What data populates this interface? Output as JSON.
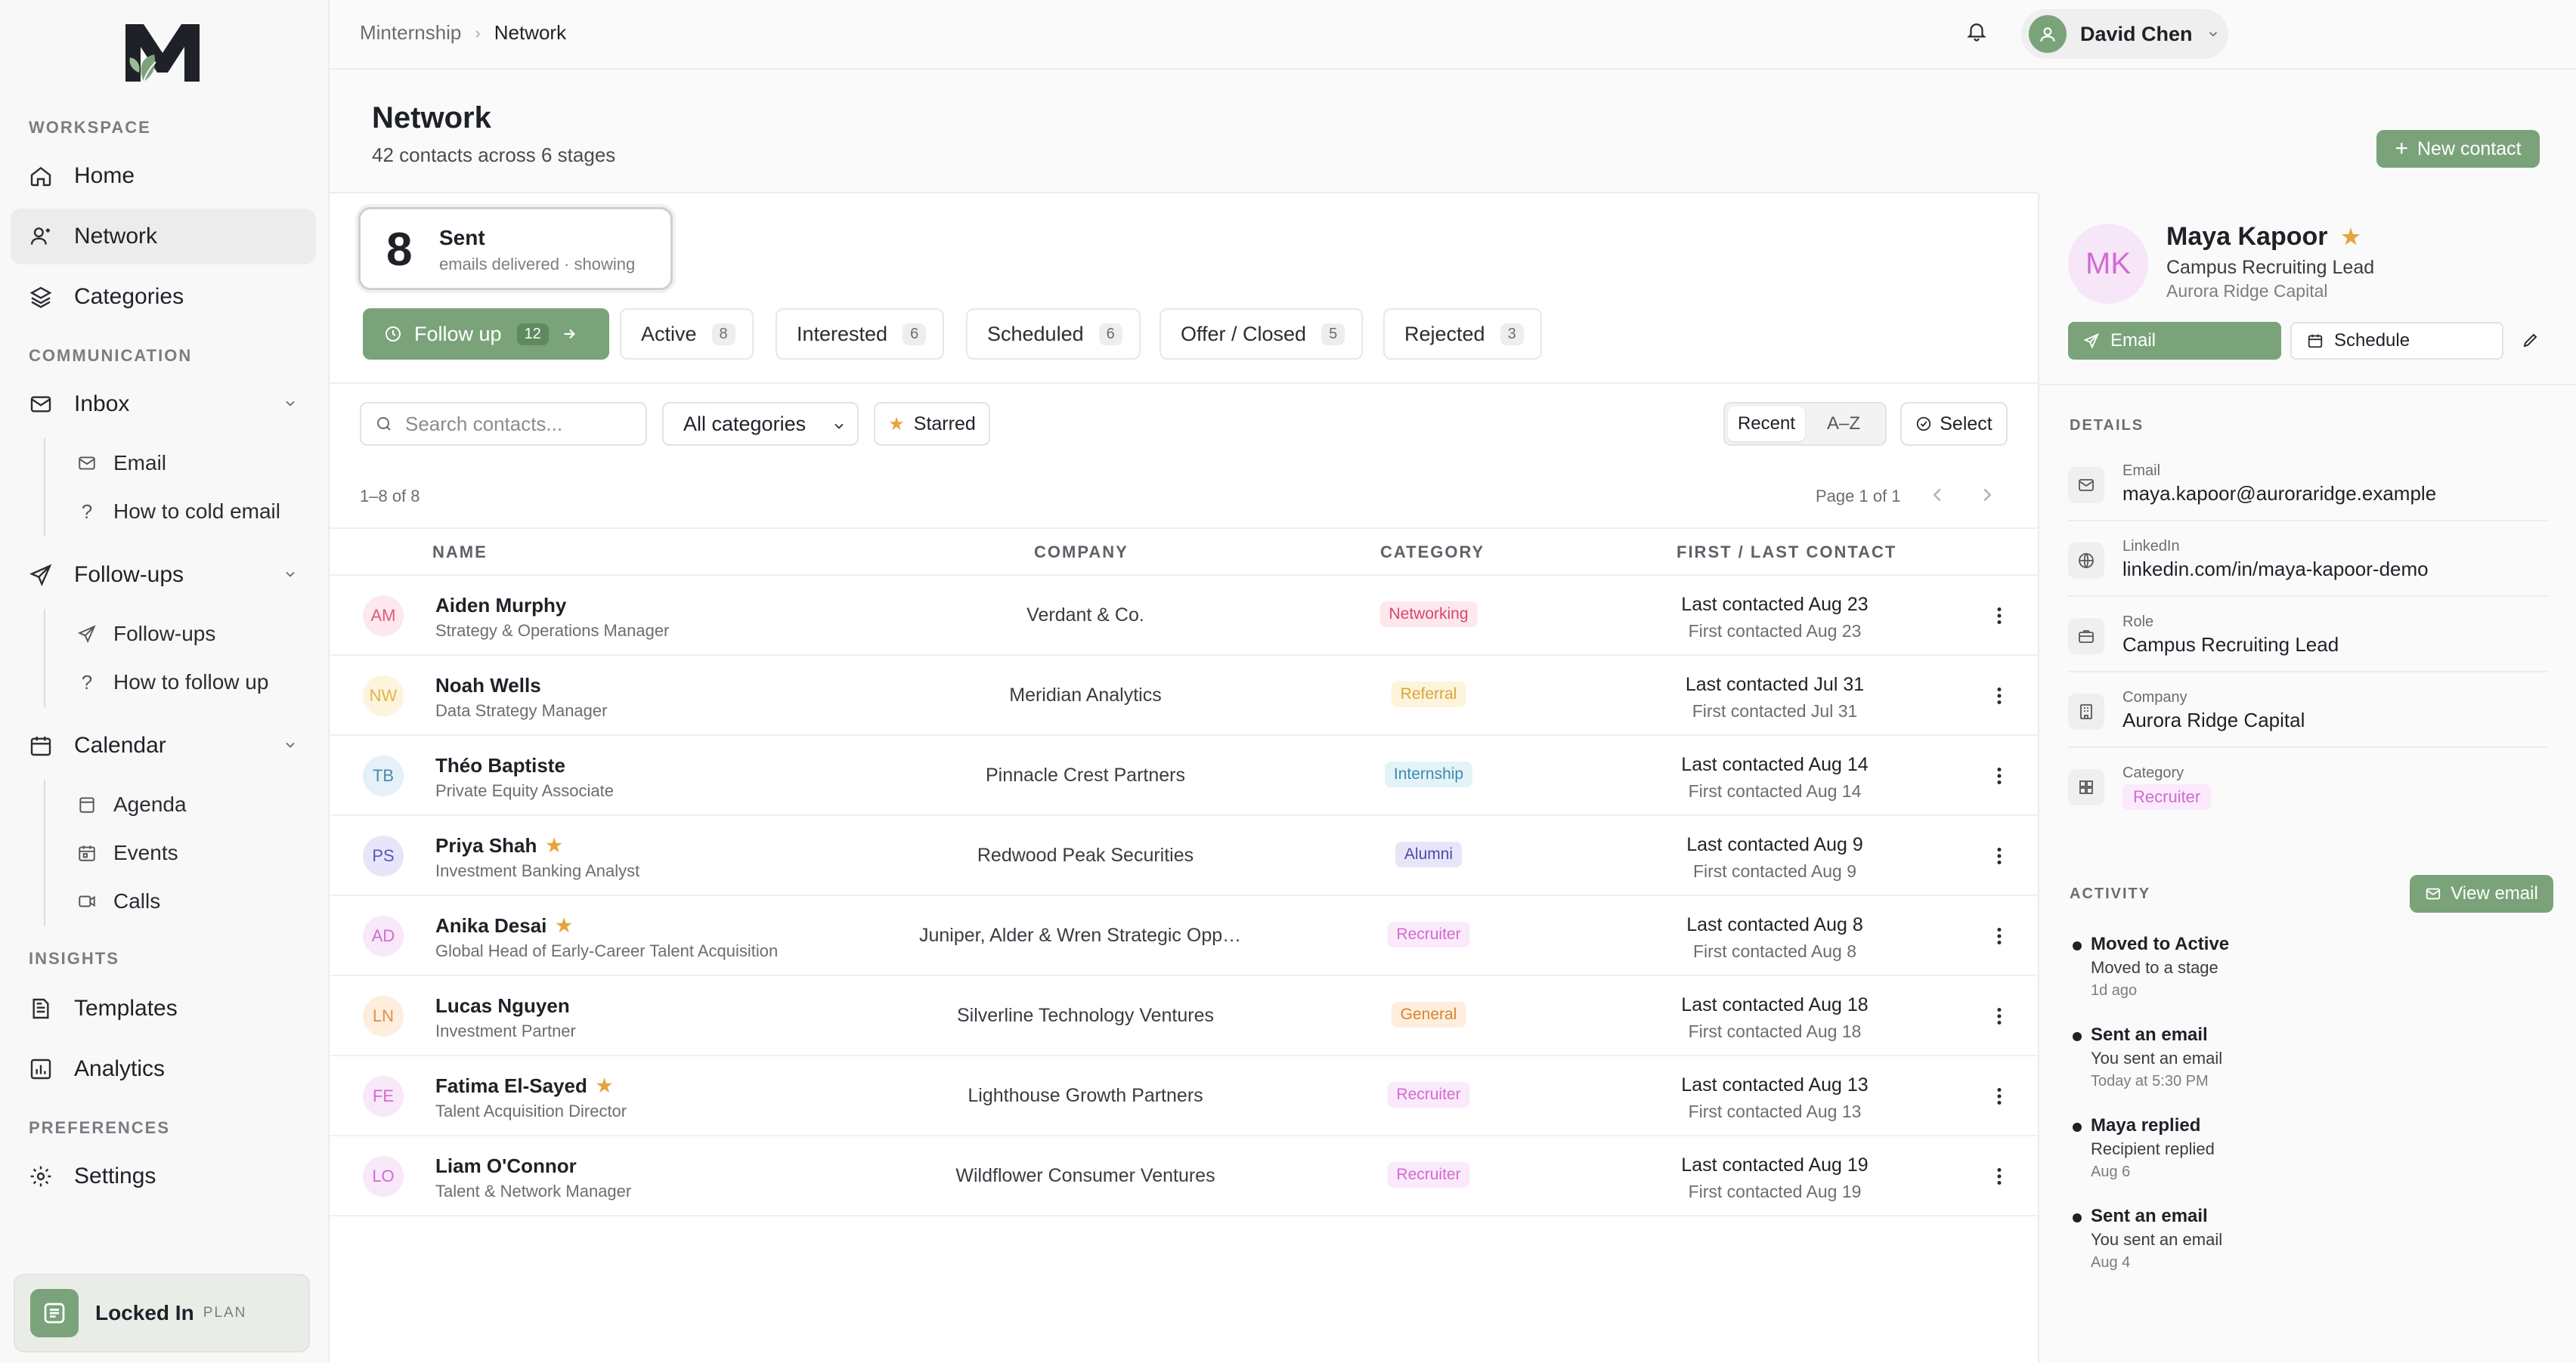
{
  "brand": {
    "accent": "#7aa37a"
  },
  "breadcrumb": {
    "root": "Minternship",
    "current": "Network"
  },
  "user": {
    "name": "David Chen"
  },
  "sidebar": {
    "sections": {
      "workspace": "WORKSPACE",
      "communication": "COMMUNICATION",
      "insights": "INSIGHTS",
      "preferences": "PREFERENCES"
    },
    "home": "Home",
    "network": "Network",
    "categories": "Categories",
    "inbox": "Inbox",
    "inbox_email": "Email",
    "inbox_cold": "How to cold email",
    "followups": "Follow-ups",
    "followups_sub": "Follow-ups",
    "followups_how": "How to follow up",
    "calendar": "Calendar",
    "agenda": "Agenda",
    "events": "Events",
    "calls": "Calls",
    "templates": "Templates",
    "analytics": "Analytics",
    "settings": "Settings",
    "plan_name": "Locked In",
    "plan_label": "PLAN"
  },
  "page": {
    "title": "Network",
    "subtitle": "42 contacts across 6 stages",
    "new_contact": "New contact"
  },
  "sent_card": {
    "count": "8",
    "label": "Sent",
    "sub": "emails delivered · showing"
  },
  "stages": [
    {
      "label": "Follow up",
      "count": "12"
    },
    {
      "label": "Active",
      "count": "8"
    },
    {
      "label": "Interested",
      "count": "6"
    },
    {
      "label": "Scheduled",
      "count": "6"
    },
    {
      "label": "Offer / Closed",
      "count": "5"
    },
    {
      "label": "Rejected",
      "count": "3"
    }
  ],
  "filters": {
    "search_placeholder": "Search contacts...",
    "category": "All categories",
    "starred": "Starred",
    "sort_recent": "Recent",
    "sort_az": "A–Z",
    "select": "Select"
  },
  "table": {
    "range": "1–8 of 8",
    "page": "Page 1 of 1",
    "headers": {
      "name": "NAME",
      "company": "COMPANY",
      "category": "CATEGORY",
      "contact": "FIRST / LAST CONTACT"
    },
    "rows": [
      {
        "initials": "AM",
        "name": "Aiden Murphy",
        "role": "Strategy & Operations Manager",
        "company": "Verdant & Co.",
        "category": "Networking",
        "last": "Last contacted Aug 23",
        "first": "First contacted Aug 23",
        "starred": false,
        "avatar_bg": "#fde8ee",
        "avatar_fg": "#e05a7a",
        "cat_bg": "#fde8ee",
        "cat_fg": "#d9466a"
      },
      {
        "initials": "NW",
        "name": "Noah Wells",
        "role": "Data Strategy Manager",
        "company": "Meridian Analytics",
        "category": "Referral",
        "last": "Last contacted Jul 31",
        "first": "First contacted Jul 31",
        "starred": false,
        "avatar_bg": "#fdf4dc",
        "avatar_fg": "#e0b64a",
        "cat_bg": "#fdf4dc",
        "cat_fg": "#d8a63a"
      },
      {
        "initials": "TB",
        "name": "Théo Baptiste",
        "role": "Private Equity Associate",
        "company": "Pinnacle Crest Partners",
        "category": "Internship",
        "last": "Last contacted Aug 14",
        "first": "First contacted Aug 14",
        "starred": false,
        "avatar_bg": "#e4f1f7",
        "avatar_fg": "#4a8aa6",
        "cat_bg": "#e4f3f8",
        "cat_fg": "#3a8bb0"
      },
      {
        "initials": "PS",
        "name": "Priya Shah",
        "role": "Investment Banking Analyst",
        "company": "Redwood Peak Securities",
        "category": "Alumni",
        "last": "Last contacted Aug 9",
        "first": "First contacted Aug 9",
        "starred": true,
        "avatar_bg": "#e7e6f8",
        "avatar_fg": "#5a55b8",
        "cat_bg": "#e7e6f8",
        "cat_fg": "#4e48b0"
      },
      {
        "initials": "AD",
        "name": "Anika Desai",
        "role": "Global Head of Early-Career Talent Acquisition",
        "company": "Juniper, Alder & Wren Strategic Opport...",
        "category": "Recruiter",
        "last": "Last contacted Aug 8",
        "first": "First contacted Aug 8",
        "starred": true,
        "avatar_bg": "#f8e8f8",
        "avatar_fg": "#d06bd4",
        "cat_bg": "#fbeafb",
        "cat_fg": "#d06bd4"
      },
      {
        "initials": "LN",
        "name": "Lucas Nguyen",
        "role": "Investment Partner",
        "company": "Silverline Technology Ventures",
        "category": "General",
        "last": "Last contacted Aug 18",
        "first": "First contacted Aug 18",
        "starred": false,
        "avatar_bg": "#fdeede",
        "avatar_fg": "#e0904a",
        "cat_bg": "#fdeede",
        "cat_fg": "#d8842e"
      },
      {
        "initials": "FE",
        "name": "Fatima El-Sayed",
        "role": "Talent Acquisition Director",
        "company": "Lighthouse Growth Partners",
        "category": "Recruiter",
        "last": "Last contacted Aug 13",
        "first": "First contacted Aug 13",
        "starred": true,
        "avatar_bg": "#f8e8f8",
        "avatar_fg": "#d06bd4",
        "cat_bg": "#fbeafb",
        "cat_fg": "#d06bd4"
      },
      {
        "initials": "LO",
        "name": "Liam O'Connor",
        "role": "Talent & Network Manager",
        "company": "Wildflower Consumer Ventures",
        "category": "Recruiter",
        "last": "Last contacted Aug 19",
        "first": "First contacted Aug 19",
        "starred": false,
        "avatar_bg": "#f8e8f8",
        "avatar_fg": "#d06bd4",
        "cat_bg": "#fbeafb",
        "cat_fg": "#d06bd4"
      }
    ]
  },
  "profile": {
    "initials": "MK",
    "name": "Maya Kapoor",
    "role": "Campus Recruiting Lead",
    "company": "Aurora Ridge Capital",
    "email_button": "Email",
    "schedule_button": "Schedule",
    "details_label": "DETAILS",
    "details": [
      {
        "key": "Email",
        "value": "maya.kapoor@auroraridge.example",
        "icon": "mail-icon"
      },
      {
        "key": "LinkedIn",
        "value": "linkedin.com/in/maya-kapoor-demo",
        "icon": "globe-icon"
      },
      {
        "key": "Role",
        "value": "Campus Recruiting Lead",
        "icon": "briefcase-icon"
      },
      {
        "key": "Company",
        "value": "Aurora Ridge Capital",
        "icon": "building-icon"
      },
      {
        "key": "Category",
        "value": "Recruiter",
        "icon": "grid-icon"
      }
    ],
    "activity_label": "ACTIVITY",
    "view_email": "View email",
    "activity": [
      {
        "title": "Moved to Active",
        "desc": "Moved to a stage",
        "when": "1d ago"
      },
      {
        "title": "Sent an email",
        "desc": "You sent an email",
        "when": "Today at 5:30 PM"
      },
      {
        "title": "Maya replied",
        "desc": "Recipient replied",
        "when": "Aug 6"
      },
      {
        "title": "Sent an email",
        "desc": "You sent an email",
        "when": "Aug 4"
      }
    ]
  }
}
